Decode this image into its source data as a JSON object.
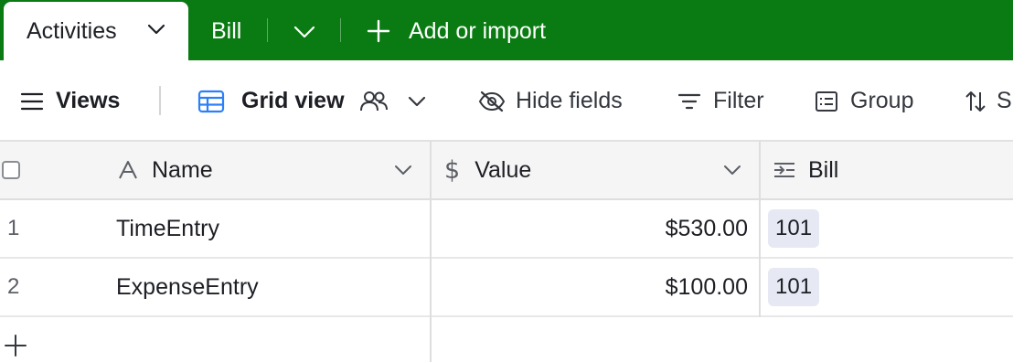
{
  "tabs": {
    "active": "Activities",
    "other": "Bill",
    "add_import": "Add or import"
  },
  "toolbar": {
    "views": "Views",
    "grid_view": "Grid view",
    "hide_fields": "Hide fields",
    "filter": "Filter",
    "group": "Group",
    "sort": "S"
  },
  "columns": [
    {
      "label": "Name",
      "icon": "text-field-icon"
    },
    {
      "label": "Value",
      "icon": "currency-field-icon"
    },
    {
      "label": "Bill",
      "icon": "linked-record-icon"
    }
  ],
  "rows": [
    {
      "num": "1",
      "name": "TimeEntry",
      "value": "$530.00",
      "bill": "101"
    },
    {
      "num": "2",
      "name": "ExpenseEntry",
      "value": "$100.00",
      "bill": "101"
    }
  ],
  "colors": {
    "tabbar": "#0a7b12",
    "chip": "#e6e9f3",
    "grid_icon": "#2d7ff9"
  }
}
